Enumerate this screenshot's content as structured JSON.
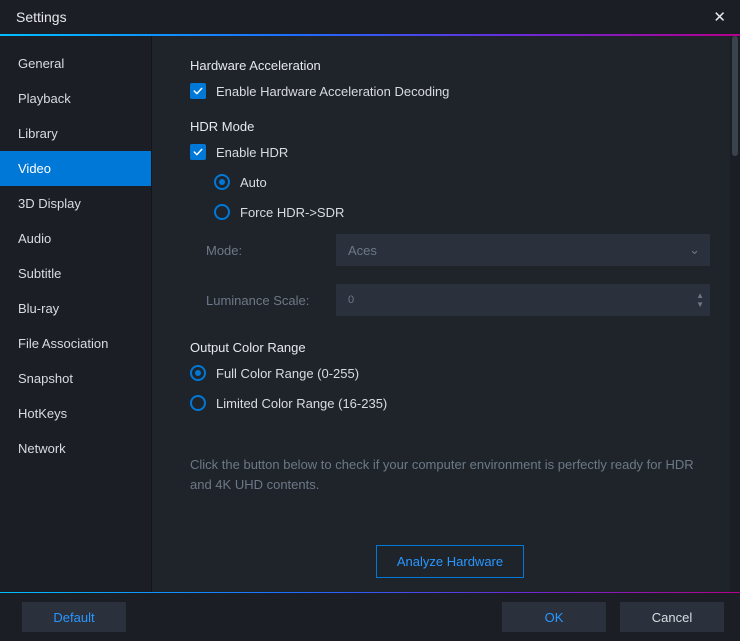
{
  "window": {
    "title": "Settings"
  },
  "sidebar": {
    "items": [
      "General",
      "Playback",
      "Library",
      "Video",
      "3D Display",
      "Audio",
      "Subtitle",
      "Blu-ray",
      "File Association",
      "Snapshot",
      "HotKeys",
      "Network"
    ],
    "active_index": 3
  },
  "content": {
    "hw_accel": {
      "title": "Hardware Acceleration",
      "enable_label": "Enable Hardware Acceleration Decoding",
      "enable_checked": true
    },
    "hdr": {
      "title": "HDR Mode",
      "enable_label": "Enable HDR",
      "enable_checked": true,
      "options": [
        "Auto",
        "Force HDR->SDR"
      ],
      "selected_option_index": 0,
      "mode_label": "Mode:",
      "mode_value": "Aces",
      "luminance_label": "Luminance Scale:",
      "luminance_value": "0"
    },
    "color_range": {
      "title": "Output Color Range",
      "options": [
        "Full Color Range (0-255)",
        "Limited Color Range (16-235)"
      ],
      "selected_option_index": 0
    },
    "analyze": {
      "hint": "Click the button below to check if your computer environment is perfectly ready for HDR and 4K UHD contents.",
      "button_label": "Analyze Hardware"
    }
  },
  "footer": {
    "default_label": "Default",
    "ok_label": "OK",
    "cancel_label": "Cancel"
  },
  "colors": {
    "accent": "#0078d7",
    "link": "#2997ff",
    "bg": "#1f242b",
    "panel": "#1b1f25",
    "field": "#2a313c",
    "muted": "#6d7886"
  }
}
